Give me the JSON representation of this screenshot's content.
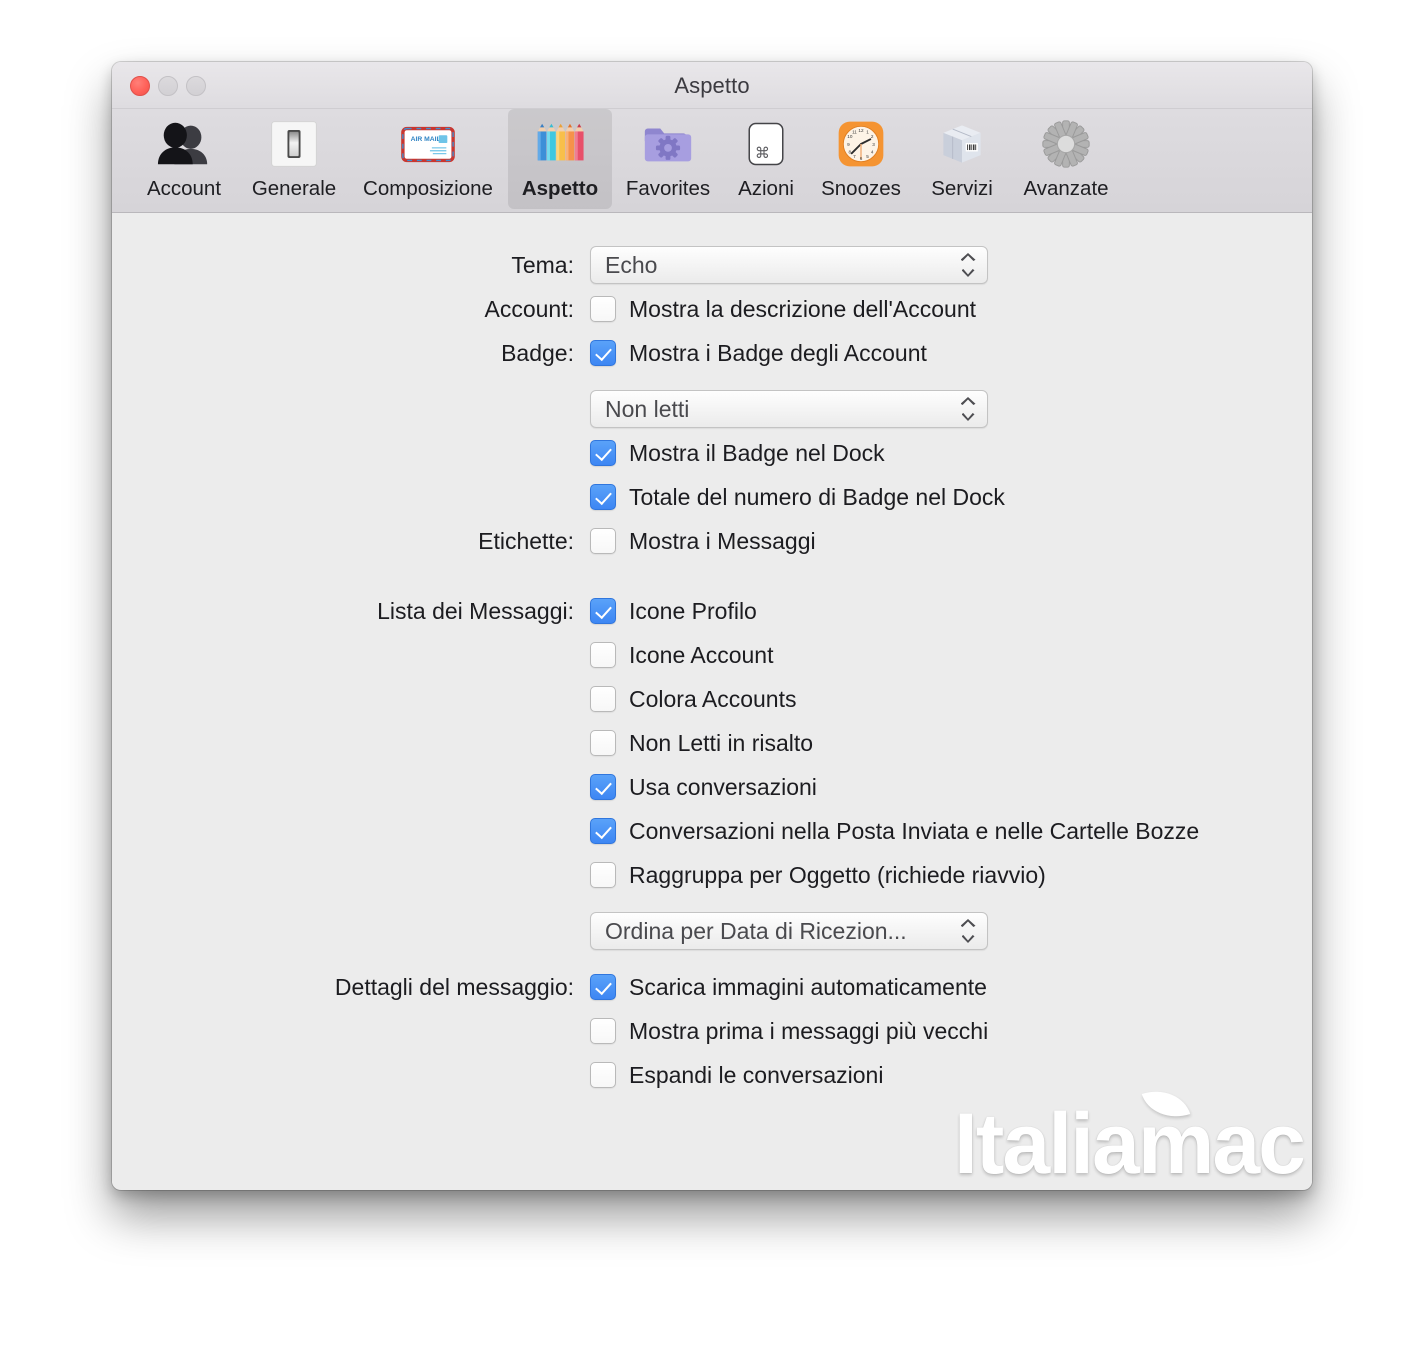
{
  "window": {
    "title": "Aspetto",
    "traffic_lights": [
      "close",
      "minimize",
      "maximize"
    ]
  },
  "toolbar": {
    "items": [
      {
        "label": "Account",
        "icon": "people-icon",
        "selected": false
      },
      {
        "label": "Generale",
        "icon": "switch-icon",
        "selected": false
      },
      {
        "label": "Composizione",
        "icon": "airmail-icon",
        "selected": false
      },
      {
        "label": "Aspetto",
        "icon": "pencils-icon",
        "selected": true
      },
      {
        "label": "Favorites",
        "icon": "folder-gear-icon",
        "selected": false
      },
      {
        "label": "Azioni",
        "icon": "command-key-icon",
        "selected": false
      },
      {
        "label": "Snoozes",
        "icon": "clock-icon",
        "selected": false
      },
      {
        "label": "Servizi",
        "icon": "package-box-icon",
        "selected": false
      },
      {
        "label": "Avanzate",
        "icon": "gear-icon",
        "selected": false
      }
    ]
  },
  "form": {
    "tema": {
      "label": "Tema:",
      "value": "Echo"
    },
    "account": {
      "label": "Account:",
      "checkbox": {
        "label": "Mostra la descrizione dell'Account",
        "checked": false
      }
    },
    "badge": {
      "label": "Badge:",
      "checkbox": {
        "label": "Mostra i Badge degli Account",
        "checked": true
      },
      "select_value": "Non letti",
      "options": [
        {
          "label": "Mostra il Badge nel Dock",
          "checked": true
        },
        {
          "label": "Totale del numero di Badge nel Dock",
          "checked": true
        }
      ]
    },
    "etichette": {
      "label": "Etichette:",
      "checkbox": {
        "label": "Mostra i Messaggi",
        "checked": false
      }
    },
    "lista_messaggi": {
      "label": "Lista dei Messaggi:",
      "options": [
        {
          "label": "Icone Profilo",
          "checked": true
        },
        {
          "label": "Icone Account",
          "checked": false
        },
        {
          "label": "Colora Accounts",
          "checked": false
        },
        {
          "label": "Non Letti in risalto",
          "checked": false
        },
        {
          "label": "Usa conversazioni",
          "checked": true
        },
        {
          "label": "Conversazioni nella Posta Inviata e nelle Cartelle Bozze",
          "checked": true
        },
        {
          "label": "Raggruppa per Oggetto (richiede riavvio)",
          "checked": false
        }
      ],
      "sort_value": "Ordina per Data di Ricezion..."
    },
    "dettagli_messaggio": {
      "label": "Dettagli del messaggio:",
      "options": [
        {
          "label": "Scarica immagini automaticamente",
          "checked": true
        },
        {
          "label": "Mostra prima i messaggi più vecchi",
          "checked": false
        },
        {
          "label": "Espandi le conversazioni",
          "checked": false
        }
      ]
    }
  },
  "watermark": {
    "text": "Italiamac"
  },
  "colors": {
    "accent_checkbox": "#3d86f3",
    "close_button": "#ff6159",
    "window_background": "#ececec",
    "toolbar_background": "#d6d4d8"
  }
}
